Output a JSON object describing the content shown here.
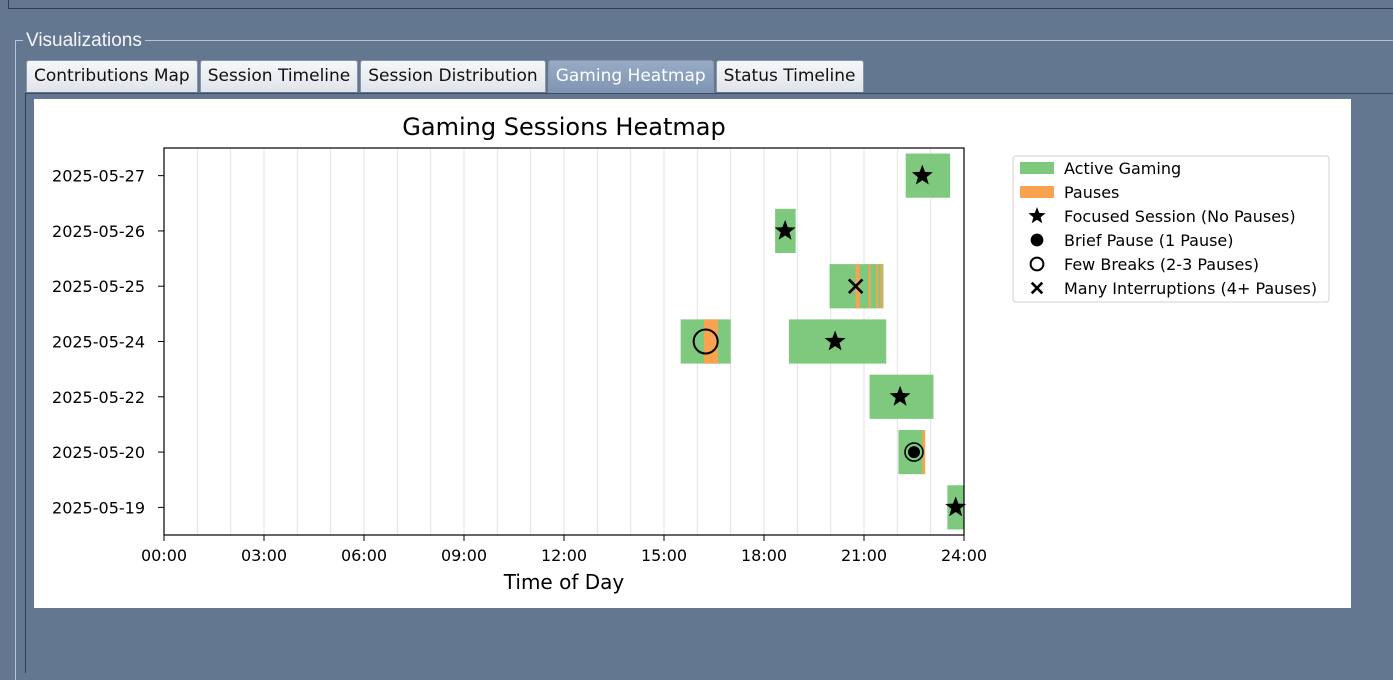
{
  "group_title": "Visualizations",
  "tabs": [
    {
      "label": "Contributions Map",
      "selected": false
    },
    {
      "label": "Session Timeline",
      "selected": false
    },
    {
      "label": "Session Distribution",
      "selected": false
    },
    {
      "label": "Gaming Heatmap",
      "selected": true
    },
    {
      "label": "Status Timeline",
      "selected": false
    }
  ],
  "chart_data": {
    "type": "heatmap",
    "title": "Gaming Sessions Heatmap",
    "xlabel": "Time of Day",
    "ylabel": "",
    "xlim": [
      0,
      24
    ],
    "x_tick_labels": [
      "00:00",
      "03:00",
      "06:00",
      "09:00",
      "12:00",
      "15:00",
      "18:00",
      "21:00",
      "24:00"
    ],
    "grid": "vertical lines every hour",
    "legend_position": "outside right, top",
    "colors": {
      "active": "#7fc97f",
      "pause": "#f9a24f",
      "marker": "#000000"
    },
    "dates": [
      "2025-05-27",
      "2025-05-26",
      "2025-05-25",
      "2025-05-24",
      "2025-05-22",
      "2025-05-20",
      "2025-05-19"
    ],
    "sessions": [
      {
        "date": "2025-05-27",
        "start": "22:15",
        "end": "23:35",
        "pauses": [],
        "marker": "star",
        "marker_time": "22:45"
      },
      {
        "date": "2025-05-26",
        "start": "18:20",
        "end": "18:57",
        "pauses": [],
        "marker": "star",
        "marker_time": "18:38"
      },
      {
        "date": "2025-05-25",
        "start": "19:58",
        "end": "21:35",
        "pauses": [
          {
            "start": "20:45",
            "end": "20:52"
          },
          {
            "start": "21:08",
            "end": "21:12"
          },
          {
            "start": "21:22",
            "end": "21:25"
          },
          {
            "start": "21:30",
            "end": "21:33"
          }
        ],
        "marker": "x",
        "marker_time": "20:45"
      },
      {
        "date": "2025-05-24",
        "start": "15:30",
        "end": "17:00",
        "pauses": [
          {
            "start": "16:12",
            "end": "16:37"
          }
        ],
        "marker": "open-circle",
        "marker_time": "16:15"
      },
      {
        "date": "2025-05-24",
        "start": "18:45",
        "end": "21:40",
        "pauses": [],
        "marker": "star",
        "marker_time": "20:08"
      },
      {
        "date": "2025-05-22",
        "start": "21:10",
        "end": "23:05",
        "pauses": [],
        "marker": "star",
        "marker_time": "22:05"
      },
      {
        "date": "2025-05-20",
        "start": "22:02",
        "end": "22:50",
        "pauses": [
          {
            "start": "22:45",
            "end": "22:50"
          }
        ],
        "marker": "filled-circle",
        "marker_time": "22:30"
      },
      {
        "date": "2025-05-19",
        "start": "23:30",
        "end": "24:00",
        "pauses": [],
        "marker": "star",
        "marker_time": "23:45"
      }
    ],
    "legend": [
      {
        "label": "Active Gaming",
        "symbol": "patch-active"
      },
      {
        "label": "Pauses",
        "symbol": "patch-pause"
      },
      {
        "label": "Focused Session (No Pauses)",
        "symbol": "star"
      },
      {
        "label": "Brief Pause (1 Pause)",
        "symbol": "filled-circle"
      },
      {
        "label": "Few Breaks (2-3 Pauses)",
        "symbol": "open-circle"
      },
      {
        "label": "Many Interruptions (4+ Pauses)",
        "symbol": "x"
      }
    ]
  }
}
